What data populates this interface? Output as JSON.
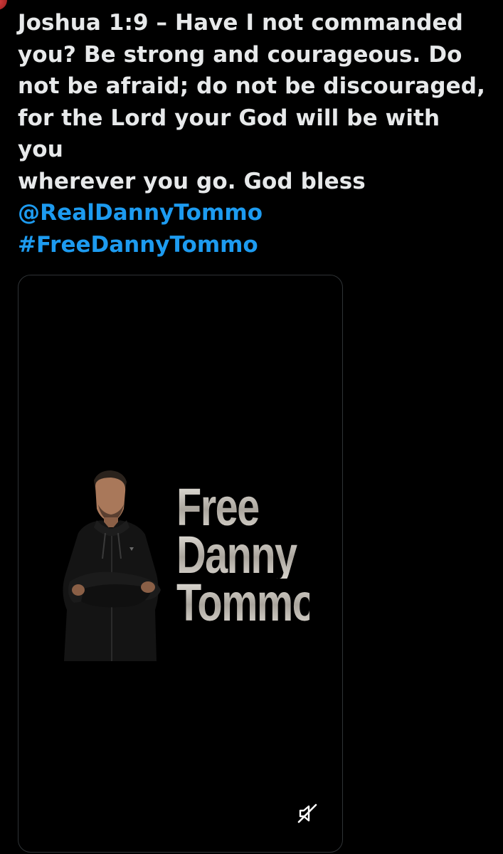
{
  "tweet": {
    "cut_line": "...any ... ... ..., ...",
    "lines": [
      "Joshua 1:9 – Have I not commanded",
      "you? Be strong and courageous. Do",
      "not be afraid; do not be discouraged,",
      "for the Lord your God will be with you",
      "wherever you go. God bless"
    ],
    "mention": "@RealDannyTommo",
    "hashtag": "#FreeDannyTommo"
  },
  "media": {
    "title_lines": [
      "Free",
      "Danny",
      "Tommo"
    ],
    "mute_icon": "muted-speaker-icon"
  },
  "colors": {
    "background": "#000000",
    "text": "#e7e9ea",
    "link": "#1d9bf0",
    "card_border": "#2f3336"
  }
}
